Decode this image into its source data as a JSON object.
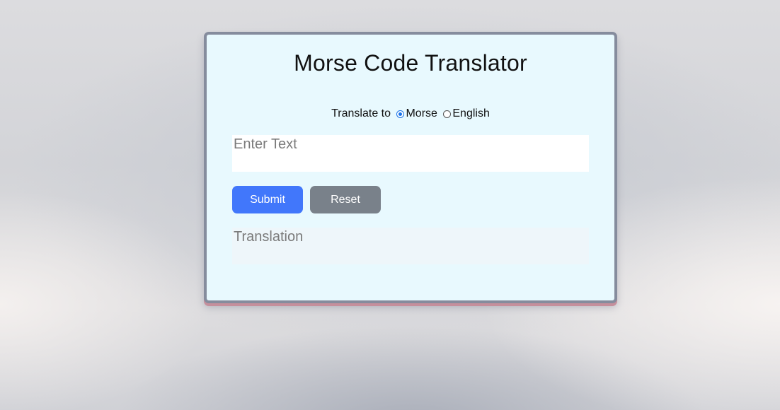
{
  "app": {
    "title": "Morse Code Translator"
  },
  "translate_option": {
    "label": "Translate to",
    "options": [
      {
        "label": "Morse",
        "selected": true
      },
      {
        "label": "English",
        "selected": false
      }
    ]
  },
  "input": {
    "placeholder": "Enter Text",
    "value": ""
  },
  "buttons": {
    "submit_label": "Submit",
    "reset_label": "Reset"
  },
  "output": {
    "placeholder": "Translation",
    "value": ""
  },
  "colors": {
    "card_background": "#e8f9fe",
    "card_border": "#858c9d",
    "submit": "#4177fb",
    "reset": "#79818a"
  }
}
